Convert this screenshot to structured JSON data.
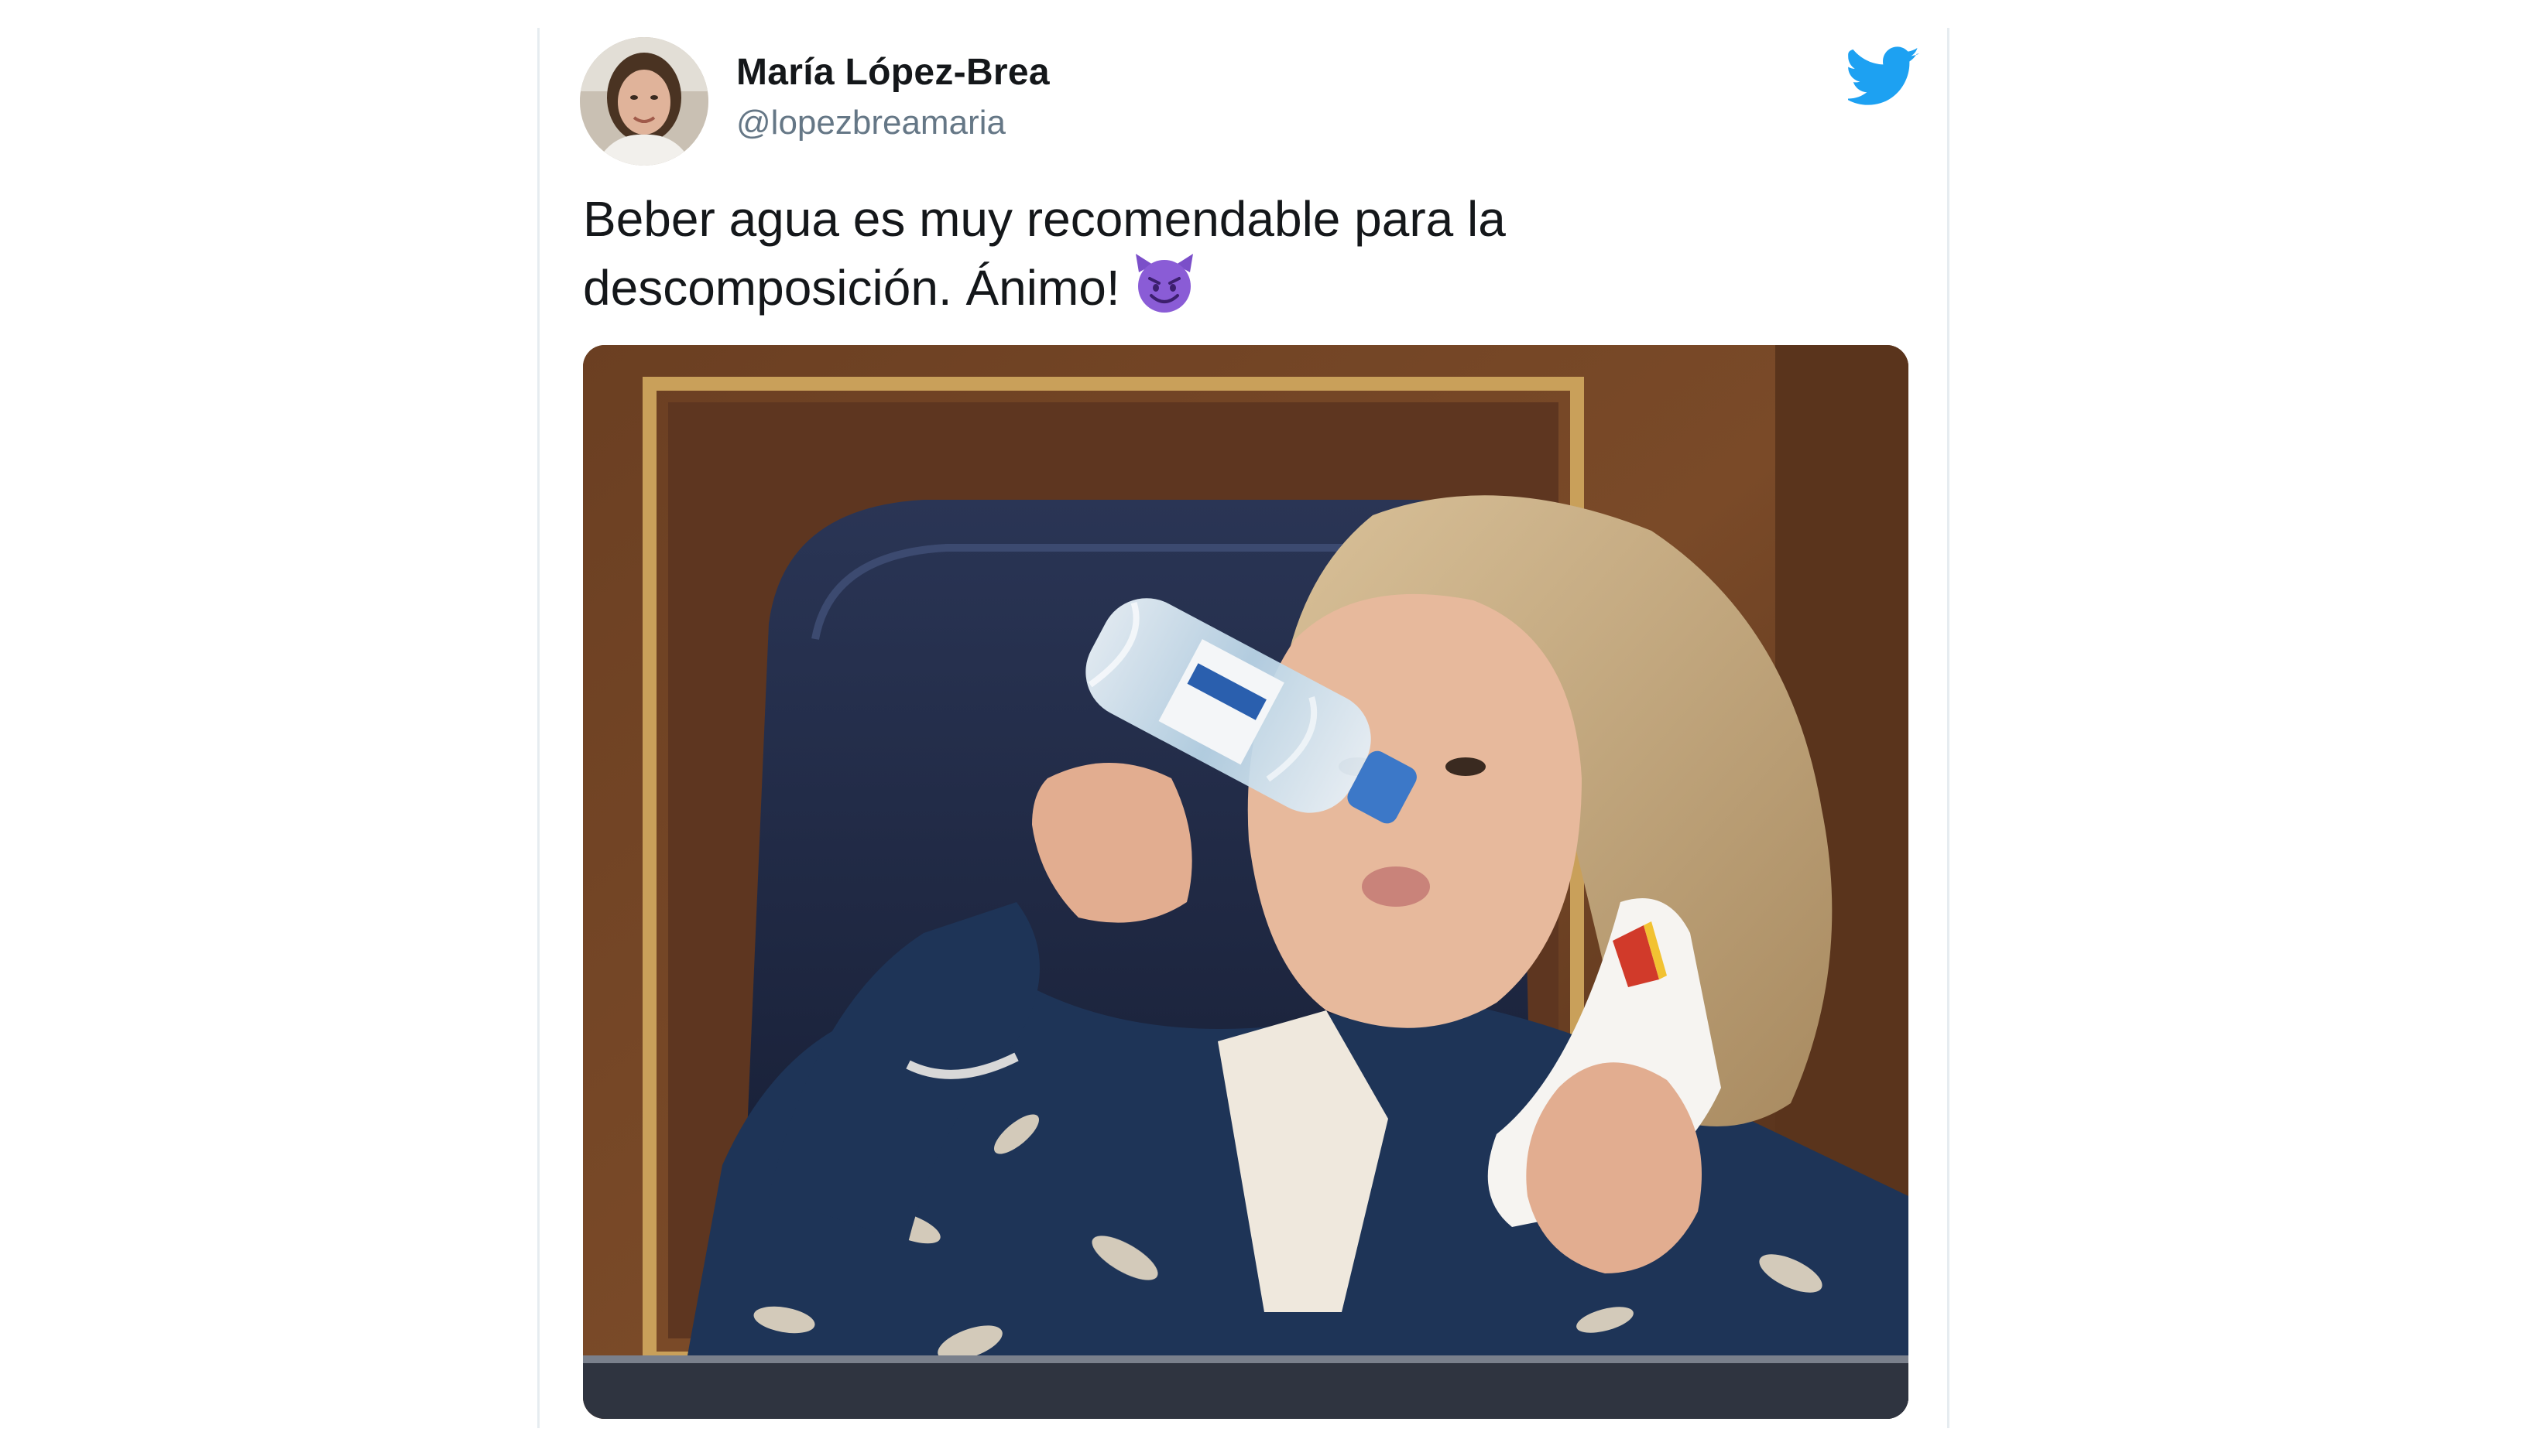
{
  "tweet": {
    "author_name": "María López-Brea",
    "author_handle": "@lopezbreamaria",
    "text_line_1": "Beber agua es muy recomendable para la",
    "text_line_2": "descomposición. Ánimo!",
    "emoji": "smiling-face-with-horns-emoji",
    "avatar_icon": "user-avatar-photo",
    "logo_icon": "twitter-bird-icon",
    "media_image": "photo-woman-drinking-water-bottle-in-parliament-seat"
  },
  "colors": {
    "brand": "#1da1f2",
    "text": "#14171a",
    "secondary_text": "#657786",
    "emoji": "#7b4fc9"
  }
}
